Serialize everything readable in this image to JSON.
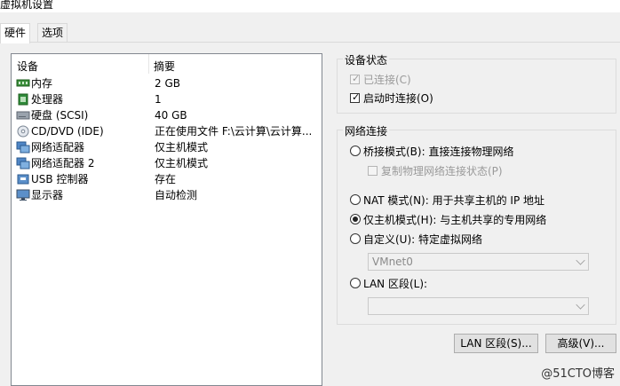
{
  "window": {
    "title": "虚拟机设置"
  },
  "tabs": [
    {
      "label": "硬件",
      "active": true
    },
    {
      "label": "选项",
      "active": false
    }
  ],
  "devices": {
    "header": {
      "device": "设备",
      "summary": "摘要"
    },
    "rows": [
      {
        "name": "内存",
        "summary": "2 GB",
        "icon": "memory-icon"
      },
      {
        "name": "处理器",
        "summary": "1",
        "icon": "cpu-icon"
      },
      {
        "name": "硬盘 (SCSI)",
        "summary": "40 GB",
        "icon": "harddisk-icon"
      },
      {
        "name": "CD/DVD (IDE)",
        "summary": "正在使用文件 F:\\云计算\\云计算...",
        "icon": "cd-icon"
      },
      {
        "name": "网络适配器",
        "summary": "仅主机模式",
        "icon": "network-adapter-icon"
      },
      {
        "name": "网络适配器 2",
        "summary": "仅主机模式",
        "icon": "network-adapter-icon"
      },
      {
        "name": "USB 控制器",
        "summary": "存在",
        "icon": "usb-icon"
      },
      {
        "name": "显示器",
        "summary": "自动检测",
        "icon": "monitor-icon"
      }
    ]
  },
  "device_status": {
    "title": "设备状态",
    "connected": {
      "label": "已连接(C)",
      "checked": true,
      "disabled": true
    },
    "connect_at_power_on": {
      "label": "启动时连接(O)",
      "checked": true
    }
  },
  "network_connection": {
    "title": "网络连接",
    "bridged": {
      "label": "桥接模式(B): 直接连接物理网络",
      "selected": false
    },
    "replicate": {
      "label": "复制物理网络连接状态(P)",
      "checked": false,
      "disabled": true
    },
    "nat": {
      "label": "NAT 模式(N): 用于共享主机的 IP 地址",
      "selected": false
    },
    "host_only": {
      "label": "仅主机模式(H): 与主机共享的专用网络",
      "selected": true
    },
    "custom": {
      "label": "自定义(U): 特定虚拟网络",
      "selected": false
    },
    "custom_select": {
      "value": "VMnet0"
    },
    "lan_segment": {
      "label": "LAN 区段(L):",
      "selected": false
    },
    "lan_select": {
      "value": ""
    }
  },
  "buttons": {
    "lan_segments": "LAN 区段(S)...",
    "advanced": "高级(V)..."
  },
  "watermark": "@51CTO博客",
  "colors": {
    "background": "#f0f0f0",
    "list_bg": "#ffffff",
    "disabled_text": "#9a9a9a"
  }
}
